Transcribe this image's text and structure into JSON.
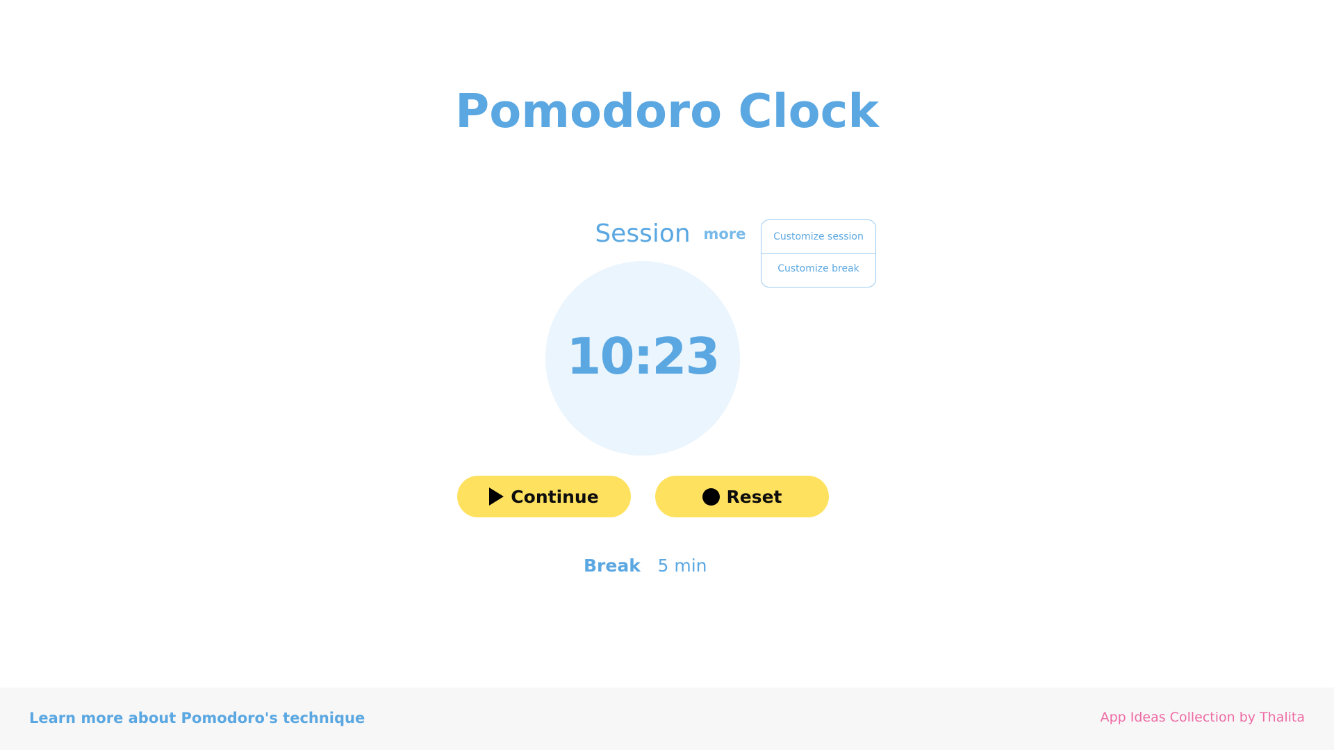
{
  "header": {
    "title": "Pomodoro Clock"
  },
  "session": {
    "label": "Session",
    "more_label": "more"
  },
  "dropdown": {
    "items": [
      {
        "label": "Customize session"
      },
      {
        "label": "Customize break"
      }
    ]
  },
  "timer": {
    "display": "10:23"
  },
  "controls": {
    "continue_label": "Continue",
    "continue_icon": "play-icon",
    "reset_label": "Reset",
    "reset_icon": "stop-icon"
  },
  "break_info": {
    "label": "Break",
    "value": "5 min"
  },
  "footer": {
    "left_link": "Learn more about Pomodoro's technique",
    "right_link": "App Ideas Collection by Thalita"
  },
  "colors": {
    "primary": "#5aa7e1",
    "button_bg": "#ffe160",
    "circle_bg": "#ebf5fd",
    "footer_bg": "#f7f7f7",
    "footer_right_text": "#ee6aa3"
  }
}
